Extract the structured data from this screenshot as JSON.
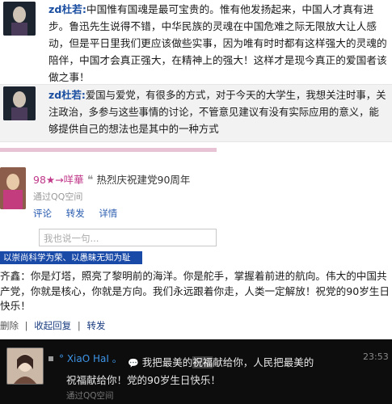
{
  "post1": {
    "user": "zd杜若:",
    "text": "中国惟有国魂是最可宝贵的。惟有他发扬起来，中国人才真有进步。鲁迅先生说得不错，中华民族的灵魂在中国危难之际无限放大让人感动，但是平日里我们更应该做些实事，因为唯有时时都有这样强大的灵魂的陪伴，中国才会真正强大，在精神上的强大！这样才是现今真正的爱国者该做之事！"
  },
  "post2": {
    "user": "zd杜若:",
    "text": "爱国与爱党，有很多的方式，对于今天的大学生，我想关注时事，关注政治，多参与这些事情的讨论，不管意见建议有没有实际应用的意义，能够提供自己的想法也是其中的一种方式"
  },
  "post3": {
    "user": "98★→咩華",
    "quote": "热烈庆祝建党90周年",
    "via": "通过QQ空间",
    "actions": [
      "评论",
      "转发",
      "详情"
    ],
    "reply_placeholder": "我也说一句..."
  },
  "group_tag": "以崇尚科学为荣、以愚昧无知为耻",
  "post4": {
    "text": "齐鑫：你是灯塔，照亮了黎明前的海洋。你是舵手，掌握着前进的航向。伟大的中国共产党，你就是核心，你就是方向。我们永远跟着你走，人类一定解放！祝党的90岁生日快乐！",
    "actions": {
      "delete": "删除",
      "sep1": "|",
      "collapse": "收起回复",
      "sep2": "|",
      "forward": "转发"
    }
  },
  "post5": {
    "nick": "° XiaO HaI 。",
    "time": "23:53",
    "line1_before": "我把最美的",
    "line1_hl": "祝福",
    "line1_after": "献给你，人民把最美的",
    "line2": "祝福献给你！党的90岁生日快乐！",
    "via": "通过QQ空间"
  }
}
